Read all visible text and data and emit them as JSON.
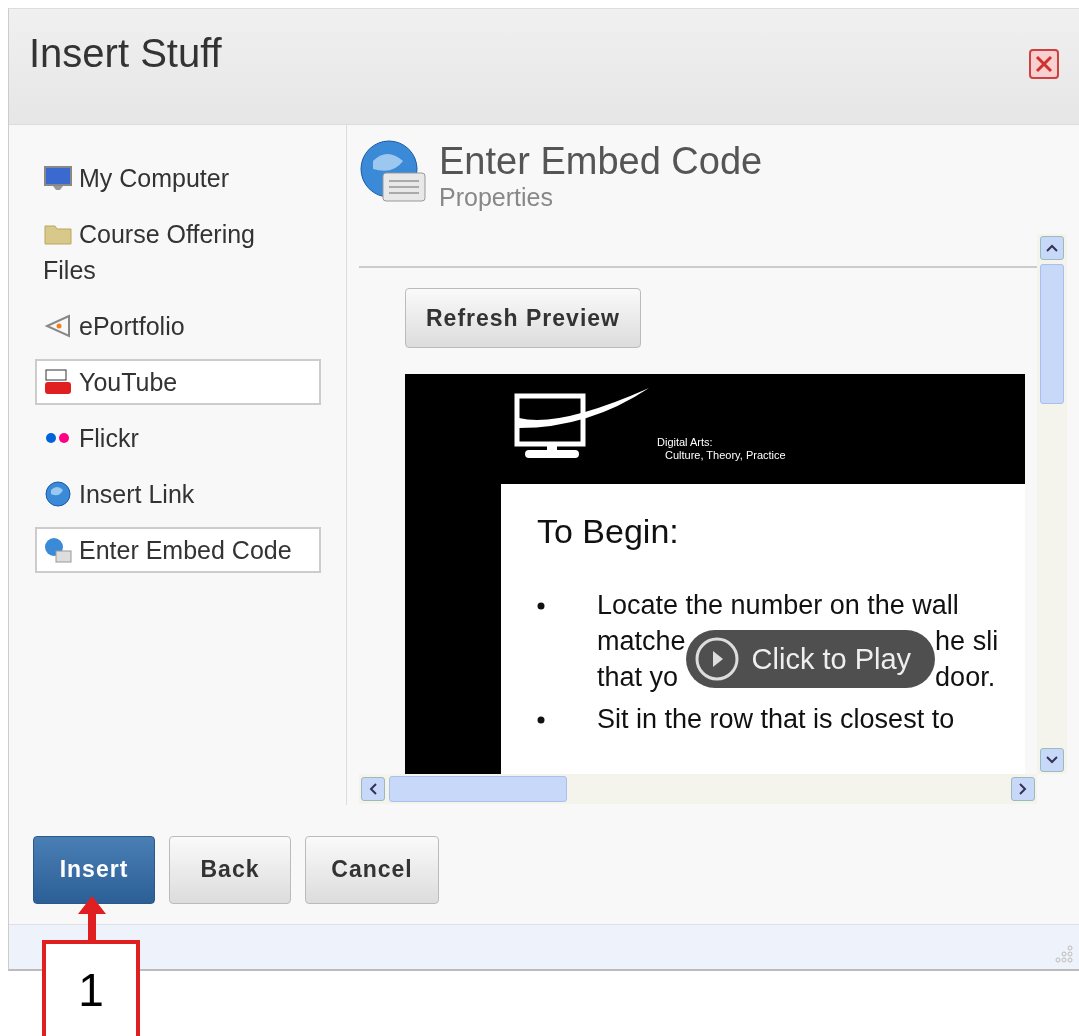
{
  "window": {
    "title": "Insert Stuff"
  },
  "sidebar": {
    "items": [
      {
        "label": "My Computer",
        "outlined": false
      },
      {
        "label": "Course Offering Files",
        "outlined": false
      },
      {
        "label": "ePortfolio",
        "outlined": false
      },
      {
        "label": "YouTube",
        "outlined": true
      },
      {
        "label": "Flickr",
        "outlined": false
      },
      {
        "label": "Insert Link",
        "outlined": false
      },
      {
        "label": "Enter Embed Code",
        "outlined": true
      }
    ]
  },
  "panel": {
    "title": "Enter Embed Code",
    "subtitle": "Properties",
    "refresh_button": "Refresh Preview",
    "preview": {
      "header_line_1": "Digital Arts:",
      "header_line_2": "Culture, Theory, Practice",
      "heading": "To Begin:",
      "bullet_1": {
        "line": "Locate the number on the wall",
        "left_parts": [
          "matche",
          "that yo"
        ],
        "right_parts": [
          "he sli",
          "door."
        ]
      },
      "play_overlay": "Click to Play",
      "bullet_2": "Sit in the row that is closest to"
    }
  },
  "buttons": [
    {
      "label": "Insert",
      "kind": "primary"
    },
    {
      "label": "Back",
      "kind": "secondary"
    },
    {
      "label": "Cancel",
      "kind": "secondary"
    }
  ],
  "annotation": {
    "label": "1"
  }
}
